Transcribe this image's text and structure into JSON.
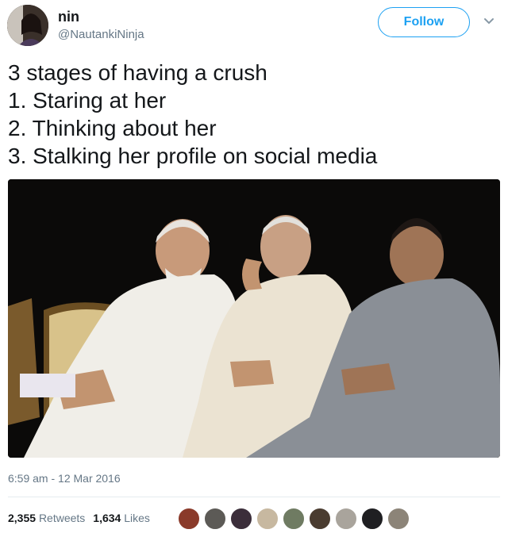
{
  "user": {
    "display_name": "nin",
    "handle": "@NautankiNinja",
    "avatar_icon": "profile-photo"
  },
  "header": {
    "follow_label": "Follow",
    "menu_icon": "chevron-down-icon",
    "accent_color": "#1da1f2"
  },
  "tweet": {
    "lines": [
      "3 stages of having a crush",
      "1. Staring at her",
      "2. Thinking about her",
      "3. Stalking her profile on social media"
    ],
    "timestamp": "6:59 am - 12 Mar 2016"
  },
  "stats": {
    "retweets_count": "2,355",
    "retweets_label": "Retweets",
    "likes_count": "1,634",
    "likes_label": "Likes",
    "liker_avatars": [
      "avatar-1",
      "avatar-2",
      "avatar-3",
      "avatar-4",
      "avatar-5",
      "avatar-6",
      "avatar-7",
      "avatar-8",
      "avatar-9"
    ]
  }
}
